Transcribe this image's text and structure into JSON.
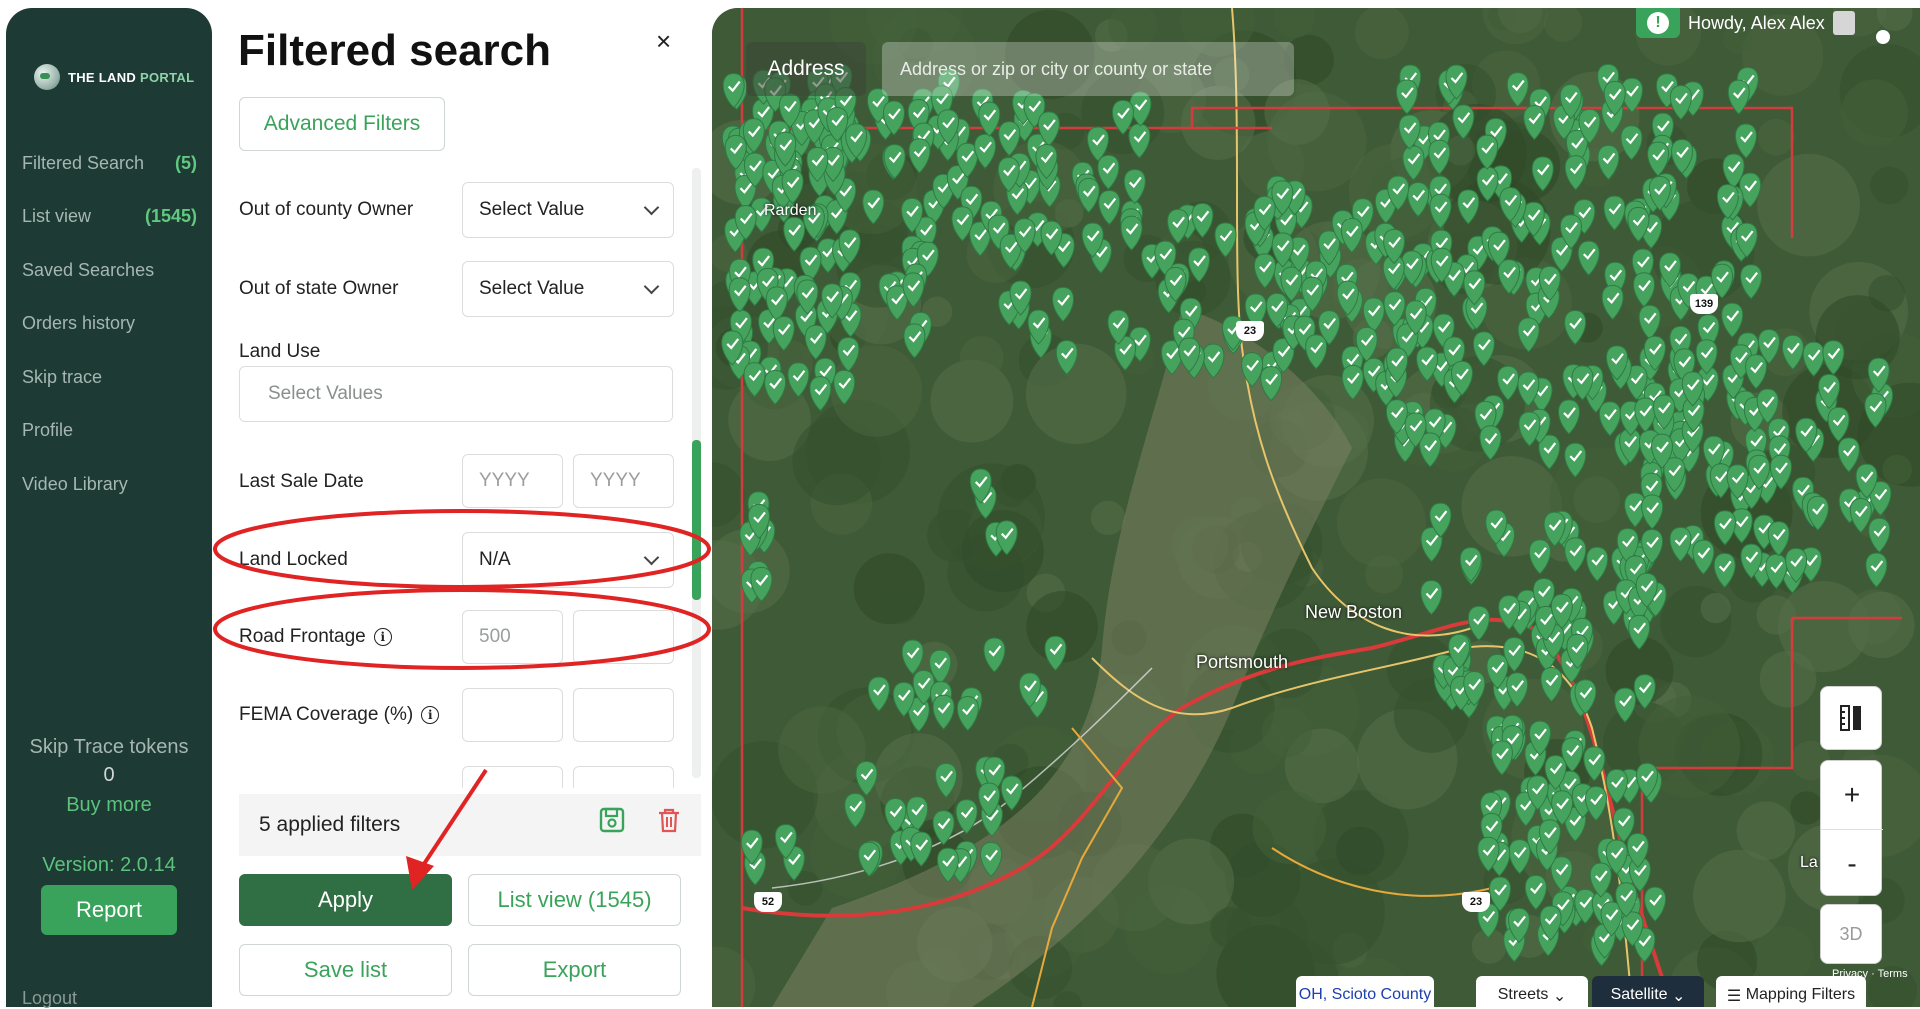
{
  "sidebar": {
    "logo_prefix": "THE LAND",
    "logo_suffix": "PORTAL",
    "items": [
      {
        "label": "Filtered Search",
        "count": "(5)"
      },
      {
        "label": "List view",
        "count": "(1545)"
      },
      {
        "label": "Saved Searches",
        "count": ""
      },
      {
        "label": "Orders history",
        "count": ""
      },
      {
        "label": "Skip trace",
        "count": ""
      },
      {
        "label": "Profile",
        "count": ""
      },
      {
        "label": "Video Library",
        "count": ""
      }
    ],
    "tokens_label": "Skip Trace tokens",
    "tokens_value": "0",
    "buy_more": "Buy more",
    "version": "Version: 2.0.14",
    "report": "Report",
    "logout": "Logout"
  },
  "panel": {
    "title": "Filtered search",
    "close": "×",
    "advanced_filters": "Advanced Filters",
    "out_of_county": {
      "label": "Out of county Owner",
      "value": "Select Value"
    },
    "out_of_state": {
      "label": "Out of state Owner",
      "value": "Select Value"
    },
    "land_use": {
      "label": "Land Use",
      "placeholder": "Select Values"
    },
    "last_sale": {
      "label": "Last Sale Date",
      "from_placeholder": "YYYY",
      "to_placeholder": "YYYY"
    },
    "land_locked": {
      "label": "Land Locked",
      "value": "N/A"
    },
    "road_frontage": {
      "label": "Road Frontage",
      "from_value": "500",
      "to_value": ""
    },
    "fema": {
      "label": "FEMA Coverage (%)"
    },
    "applied_filters": "5 applied filters",
    "apply": "Apply",
    "list_view": "List view (1545)",
    "save_list": "Save list",
    "export": "Export"
  },
  "map": {
    "address_label": "Address",
    "address_placeholder": "Address or zip or city or county or state",
    "user_greeting": "Howdy, Alex Alex",
    "places": [
      "Rarden",
      "New Boston",
      "Portsmouth"
    ],
    "route_shields": [
      "139",
      "23",
      "52",
      "23"
    ],
    "zoom_in": "+",
    "zoom_out": "-",
    "btn_3d": "3D",
    "terms": "Privacy · Terms",
    "edge_label": "La",
    "tabs": {
      "county": "OH, Scioto County",
      "streets": "Streets",
      "satellite": "Satellite",
      "map_filters": "Mapping Filters"
    }
  },
  "colors": {
    "accent": "#3aa35b",
    "sidebar_bg": "#1d3a34",
    "apply_bg": "#2f6f43",
    "annotation": "#e02424",
    "marker": "#46a35e"
  },
  "icons": [
    "globe-logo-icon",
    "close-icon",
    "chevron-down-icon",
    "info-icon",
    "save-icon",
    "trash-icon",
    "alert-icon",
    "ruler-icon",
    "map-marker-icon"
  ]
}
